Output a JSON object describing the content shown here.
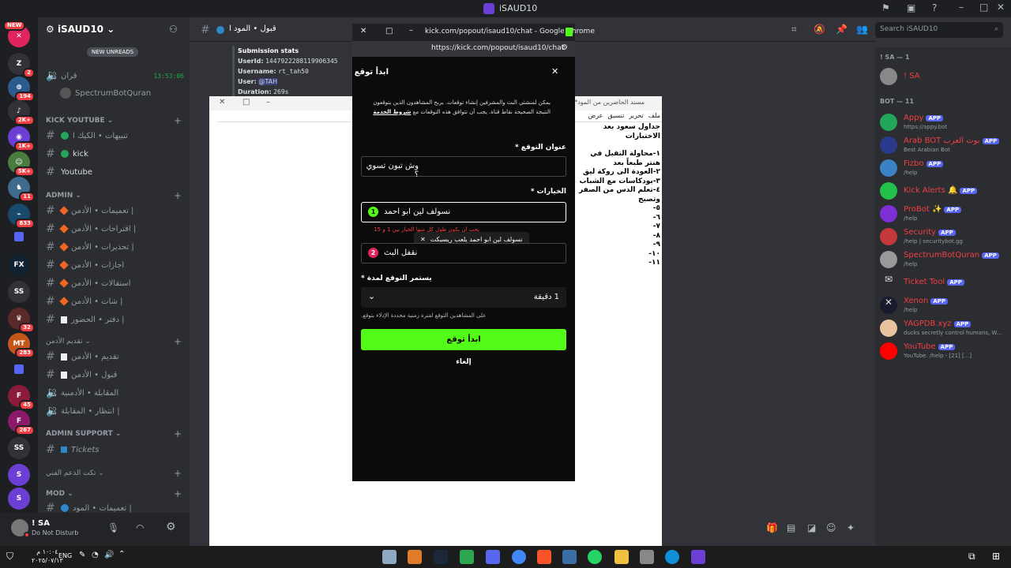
{
  "window": {
    "title": "iSAUD10"
  },
  "server": {
    "name": "iSAUD10"
  },
  "server_badges": [
    "NEW",
    "2",
    "194",
    "2K+",
    "1K+",
    "5K+",
    "11",
    "833",
    "32",
    "283",
    "45",
    "267"
  ],
  "server_labels": [
    "SS",
    "SS"
  ],
  "new_unreads": "NEW UNREADS",
  "channels": {
    "top": [
      {
        "name": "قران",
        "time": "13:53:06"
      },
      {
        "name": "SpectrumBotQuran"
      }
    ],
    "kick_cat": "KICK YOUTUBE",
    "kick": [
      "تنبيهات • الكيك ا",
      "kick",
      "Youtube"
    ],
    "admin_cat": "ADMIN",
    "admin": [
      "تعميمات • الأدمن |",
      "اقتراحات • الأدمن |",
      "تحذيرات • الأدمن |",
      "اجازات • الأدمن",
      "استقالات • الأدمن",
      "شات • الأدمن |",
      "دفتر • الحضور |"
    ],
    "apply_cat": "تقديم الأدمن",
    "apply": [
      "تقديم • الأدمن",
      "قبول • الأدمن",
      "المقابلة • الأدمنية",
      "انتظار • المقابلة |"
    ],
    "support_cat": "ADMIN SUPPORT",
    "support": [
      "Tickets"
    ],
    "ticket_cat": "تكت الدعم الفني",
    "mod_cat": "MOD",
    "mod": [
      "تعميمات • المود |"
    ]
  },
  "user": {
    "name": "! SA",
    "status": "Do Not Disturb"
  },
  "header": {
    "channel": "قبول • المود ا",
    "search": "Search iSAUD10"
  },
  "submission": {
    "title": "Submission stats",
    "userid_l": "UserId:",
    "userid": "1447922288119906345",
    "username_l": "Username:",
    "username": "rt_tah50",
    "user_l": "User:",
    "user": "@TAH",
    "duration_l": "Duration:",
    "duration": "269s"
  },
  "members": {
    "sa_head": "! SA — 1",
    "sa": [
      {
        "name": "! SA",
        "color": "#f23f43"
      }
    ],
    "bot_head": "BOT — 11",
    "bots": [
      {
        "name": "Appy",
        "status": "https://appy.bot",
        "color": "#f23f43"
      },
      {
        "name": "Arab BOT",
        "extra": "بوت العرب",
        "status": "Best Arabian Bot",
        "color": "#f23f43"
      },
      {
        "name": "Fizbo",
        "status": "/help",
        "color": "#f23f43"
      },
      {
        "name": "Kick Alerts",
        "status": "",
        "color": "#f23f43"
      },
      {
        "name": "ProBot",
        "status": "/help",
        "color": "#f23f43"
      },
      {
        "name": "Security",
        "status": "/help | securitybot.gg",
        "color": "#f23f43"
      },
      {
        "name": "SpectrumBotQuran",
        "status": "/help",
        "color": "#f23f43"
      },
      {
        "name": "Ticket Tool",
        "status": "",
        "color": "#f23f43"
      },
      {
        "name": "Xenon",
        "status": "/help",
        "color": "#f23f43"
      },
      {
        "name": "YAGPDB.xyz",
        "status": "ducks secretly control humans, W...",
        "color": "#f23f43"
      },
      {
        "name": "YouTube",
        "status": "YouTube. /help - [21] [...]",
        "color": "#f23f43"
      }
    ],
    "app_label": "APP"
  },
  "notepad": {
    "title": "*مسند الحاضرين من المود",
    "menu": [
      "ملف",
      "تحرير",
      "تنسيق",
      "عرض"
    ],
    "lines": [
      "جداول سعود بعد الاختبارات",
      "",
      "١-محاولة التقيل في هنتر طبعاً بعد",
      "٢-العودة الى روكة ليق",
      "٣-بودكاسات مع الشباب",
      "٤-تعلم الدس من الصفر وتصبح",
      "٥-",
      "٦-",
      "٧-",
      "٨-",
      "٩-",
      "١٠-",
      "١١-"
    ]
  },
  "chrome": {
    "title": "kick.com/popout/isaud10/chat - Google Chrome",
    "url": "https://kick.com/popout/isaud10/chat"
  },
  "prediction": {
    "header": "ابدأ توقع",
    "desc": "يمكن لمنشئي البث والمشرفين إنشاء توقعات. يربح المشاهدون الذين يتوقعون النتيجة الصحيحة نقاط قناة. يجب أن تتوافق هذه التوقعات مع",
    "terms": "شروط الخدمة",
    "title_label": "عنوان التوقع *",
    "title_value": "وش تبون تسوي ؟",
    "options_label": "الخيارات *",
    "opt1": "نسولف لين ابو احمد",
    "opt1_hint": "يجب أن يكون طول كل منها الخيار بين 1 و 15",
    "tooltip": "نسولف لين ابو احمد يلعب ريسبكت",
    "opt2": "نقفل البث",
    "duration_label": "يستمر التوقع لمدة *",
    "duration_value": "1 دقيقة",
    "duration_hint": "على المشاهدين التوقع لفترة زمنية محددة الإدلاء بتوقع.",
    "start": "ابدأ توقع",
    "cancel": "إلغاء"
  },
  "taskbar": {
    "time": "١٠:٠٤ م",
    "date": "٢٠٢٥/٠٧/١٣",
    "lang": "ENG"
  }
}
